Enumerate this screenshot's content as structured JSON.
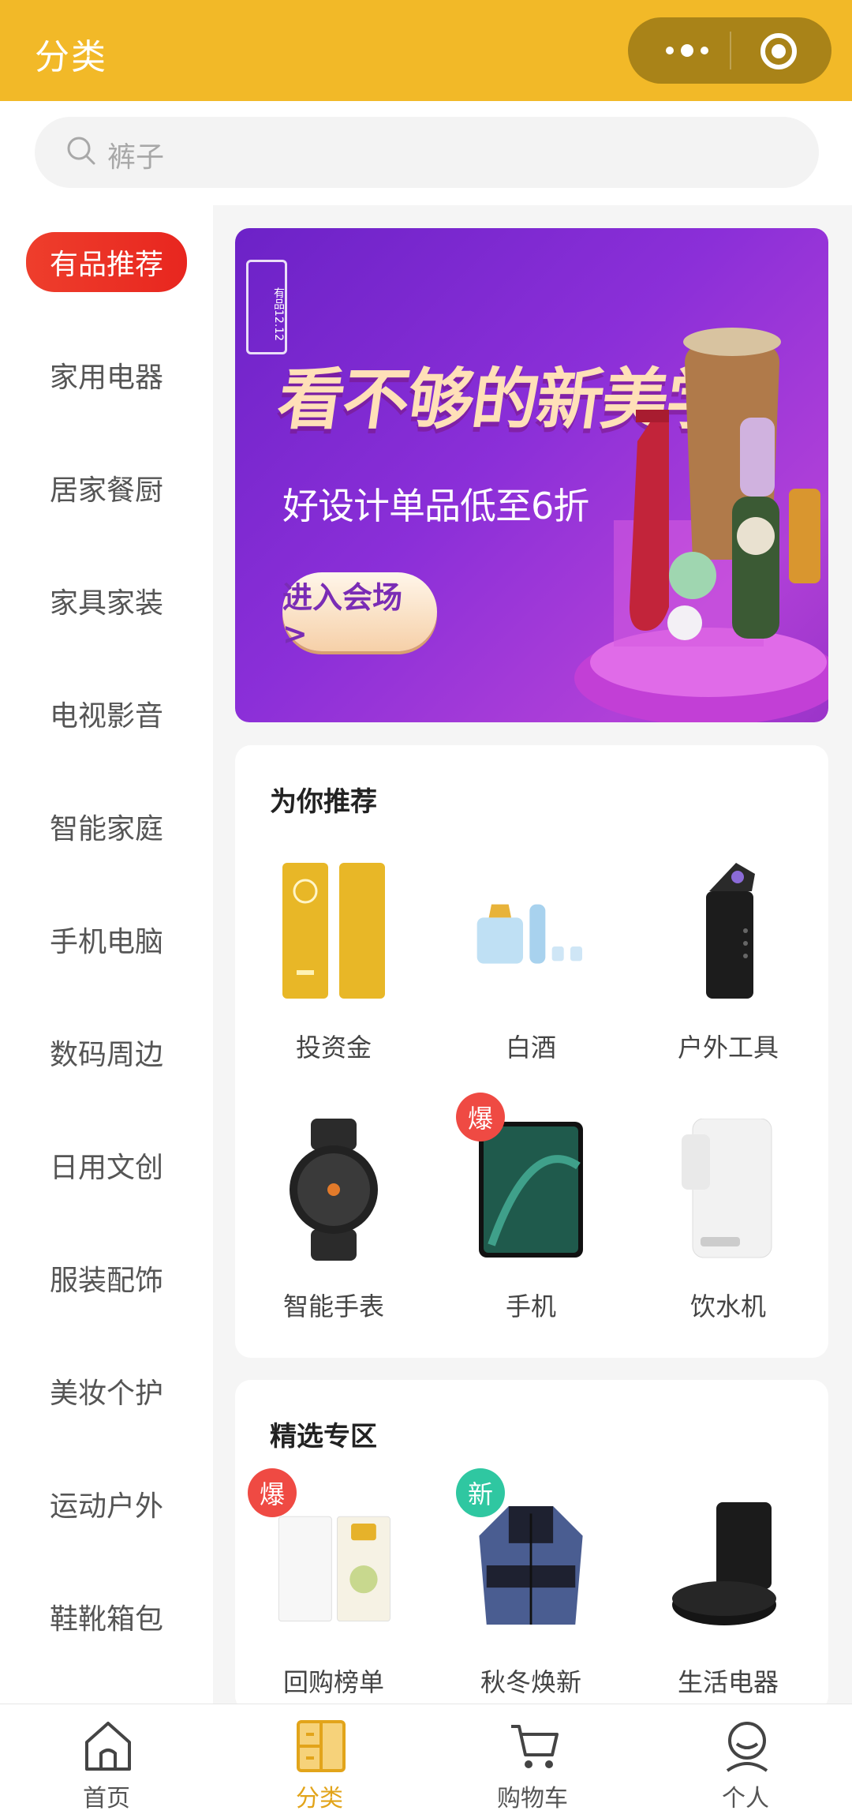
{
  "header": {
    "title": "分类"
  },
  "search": {
    "placeholder": "裤子"
  },
  "sidebar": {
    "items": [
      {
        "label": "有品推荐",
        "active": true
      },
      {
        "label": "家用电器"
      },
      {
        "label": "居家餐厨"
      },
      {
        "label": "家具家装"
      },
      {
        "label": "电视影音"
      },
      {
        "label": "智能家庭"
      },
      {
        "label": "手机电脑"
      },
      {
        "label": "数码周边"
      },
      {
        "label": "日用文创"
      },
      {
        "label": "服装配饰"
      },
      {
        "label": "美妆个护"
      },
      {
        "label": "运动户外"
      },
      {
        "label": "鞋靴箱包"
      }
    ]
  },
  "banner": {
    "badge": "有品12.12",
    "headline": "看不够的新美学",
    "subtitle": "好设计单品低至6折",
    "cta": "进入会场 >"
  },
  "recommend": {
    "title": "为你推荐",
    "items": [
      {
        "label": "投资金",
        "icon": "gold-bar-icon"
      },
      {
        "label": "白酒",
        "icon": "liquor-set-icon"
      },
      {
        "label": "户外工具",
        "icon": "lighter-icon"
      },
      {
        "label": "智能手表",
        "icon": "smartwatch-icon"
      },
      {
        "label": "手机",
        "icon": "phone-icon",
        "tag": "爆"
      },
      {
        "label": "饮水机",
        "icon": "water-dispenser-icon"
      }
    ]
  },
  "featured": {
    "title": "精选专区",
    "items": [
      {
        "label": "回购榜单",
        "icon": "milk-icon",
        "tag": "爆"
      },
      {
        "label": "秋冬焕新",
        "icon": "jacket-icon",
        "tag": "新"
      },
      {
        "label": "生活电器",
        "icon": "robot-vacuum-icon"
      }
    ]
  },
  "tabbar": {
    "items": [
      {
        "label": "首页",
        "icon": "home-icon"
      },
      {
        "label": "分类",
        "icon": "category-icon",
        "active": true
      },
      {
        "label": "购物车",
        "icon": "cart-icon"
      },
      {
        "label": "个人",
        "icon": "user-icon"
      }
    ]
  },
  "colors": {
    "brand": "#f2b928",
    "accent": "#e8261f",
    "hot_tag": "#ef4a43",
    "new_tag": "#2fc7a1"
  }
}
